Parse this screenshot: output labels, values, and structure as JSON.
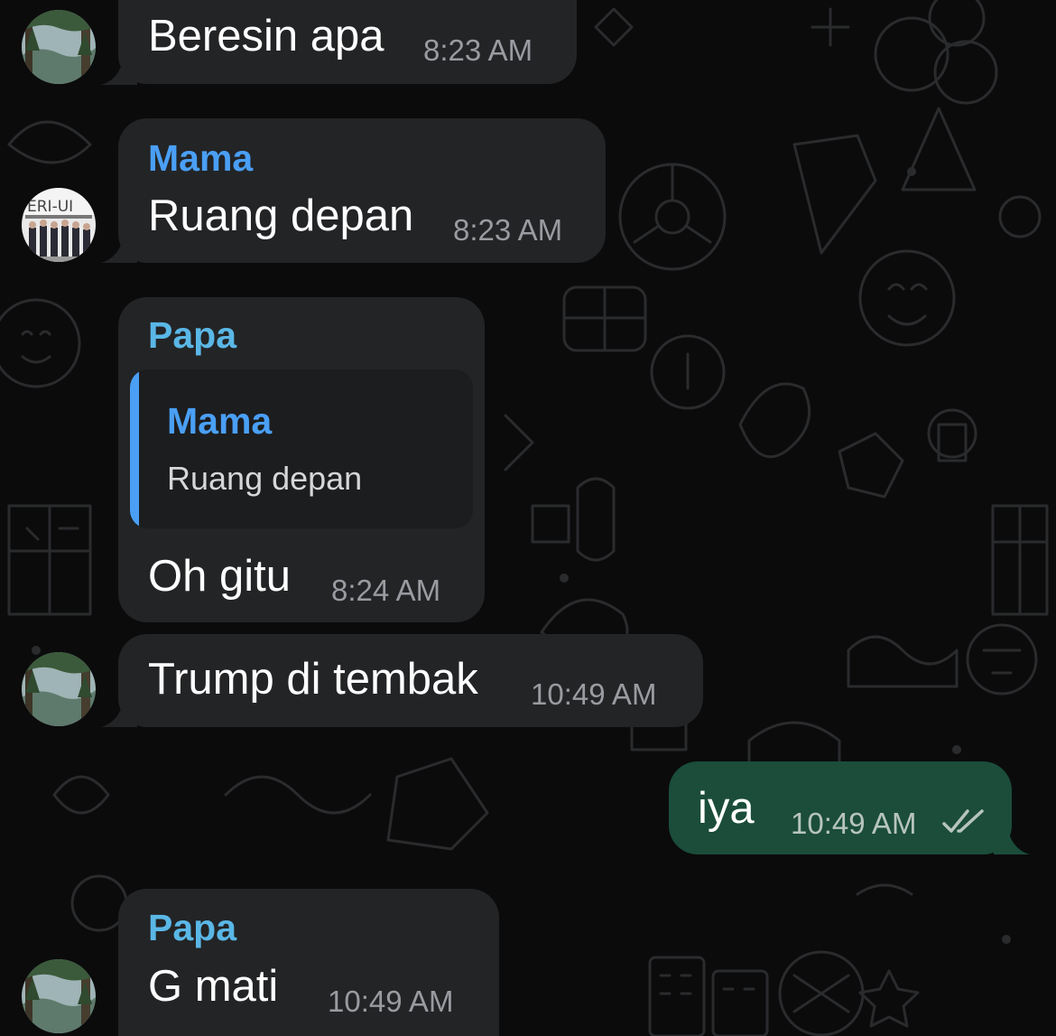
{
  "colors": {
    "mama": "#4a9ff5",
    "papa": "#5ab7e6",
    "incoming_bubble": "#232426",
    "outgoing_bubble": "#1b4d3a",
    "time_text": "#9a9ba0",
    "read_ticks": "#b7c4bd"
  },
  "messages": [
    {
      "sender": "",
      "text": "Beresin apa",
      "time": "8:23 AM"
    },
    {
      "sender": "Mama",
      "text": "Ruang depan",
      "time": "8:23 AM"
    },
    {
      "sender": "Papa",
      "reply_to": {
        "sender": "Mama",
        "text": "Ruang depan"
      },
      "text": "Oh gitu",
      "time": "8:24 AM"
    },
    {
      "sender": "",
      "text": "Trump di tembak",
      "time": "10:49 AM"
    },
    {
      "sender": "",
      "text": "iya",
      "time": "10:49 AM",
      "outgoing": true,
      "status": "read-double-check-icon"
    },
    {
      "sender": "Papa",
      "text": "G  mati",
      "time": "10:49 AM"
    }
  ],
  "avatars": [
    {
      "name": "forest-avatar",
      "description": "misty forest photo"
    },
    {
      "name": "group-photo-avatar",
      "caption": "ERI-UI"
    }
  ]
}
